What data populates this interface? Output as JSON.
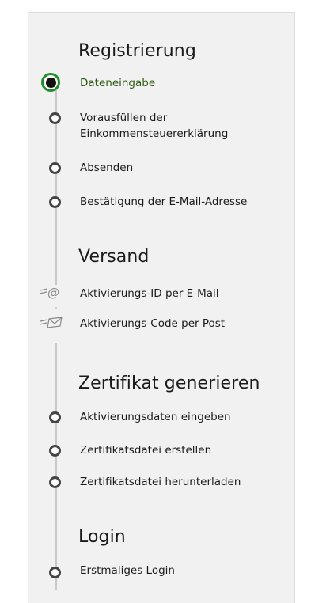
{
  "sections": [
    {
      "title": "Registrierung",
      "steps": [
        {
          "label": "Dateneingabe",
          "state": "active"
        },
        {
          "label": "Vorausfüllen der",
          "label2": "Einkommensteuererklärung",
          "state": "pending"
        },
        {
          "label": "Absenden",
          "state": "pending"
        },
        {
          "label": "Bestätigung der E-Mail-Adresse",
          "state": "pending"
        }
      ]
    },
    {
      "title": "Versand",
      "steps": [
        {
          "label": "Aktivierungs-ID per E-Mail",
          "icon": "email-at-icon"
        },
        {
          "label": "Aktivierungs-Code per Post",
          "icon": "letter-envelope-icon"
        }
      ]
    },
    {
      "title": "Zertifikat generieren",
      "steps": [
        {
          "label": "Aktivierungsdaten eingeben",
          "state": "pending"
        },
        {
          "label": "Zertifikatsdatei erstellen",
          "state": "pending"
        },
        {
          "label": "Zertifikatsdatei herunterladen",
          "state": "pending"
        }
      ]
    },
    {
      "title": "Login",
      "steps": [
        {
          "label": "Erstmaliges Login",
          "state": "pending"
        }
      ]
    }
  ],
  "colors": {
    "active_ring": "#1f8f23",
    "active_text": "#2d5a0f",
    "track": "#c8c8c8",
    "panel_bg": "#f1f1f1"
  }
}
